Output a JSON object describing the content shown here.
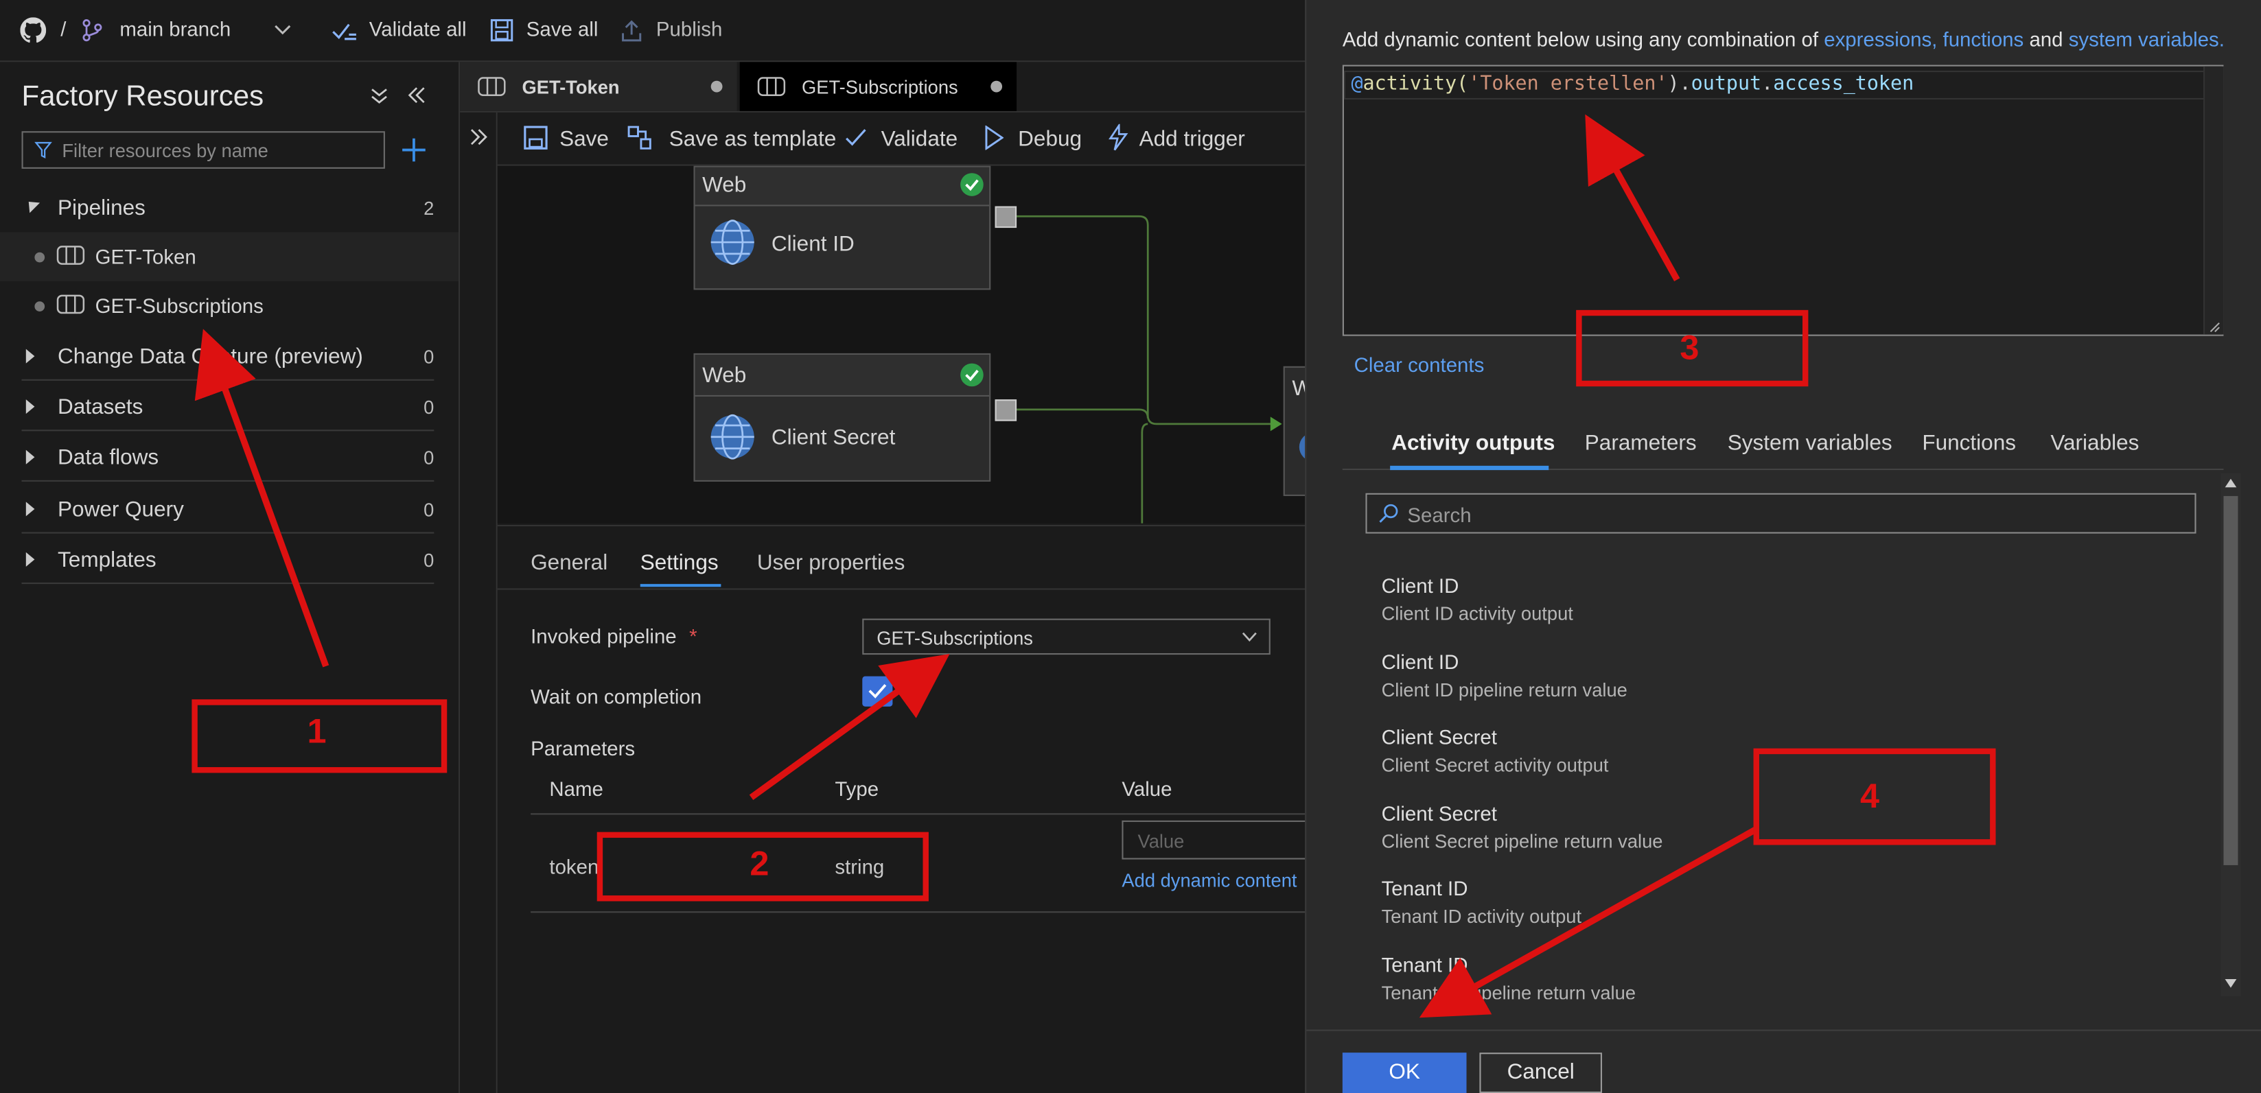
{
  "topbar": {
    "separator": "/",
    "branch": "main branch",
    "validate_all": "Validate all",
    "save_all": "Save all",
    "publish": "Publish"
  },
  "sidebar": {
    "title": "Factory Resources",
    "filter_placeholder": "Filter resources by name",
    "sections": [
      {
        "label": "Pipelines",
        "count": "2"
      },
      {
        "label": "Change Data Capture (preview)",
        "count": "0"
      },
      {
        "label": "Datasets",
        "count": "0"
      },
      {
        "label": "Data flows",
        "count": "0"
      },
      {
        "label": "Power Query",
        "count": "0"
      },
      {
        "label": "Templates",
        "count": "0"
      }
    ],
    "pipelines": [
      "GET-Token",
      "GET-Subscriptions"
    ]
  },
  "tabs": [
    "GET-Token",
    "GET-Subscriptions"
  ],
  "toolbar": {
    "save": "Save",
    "save_as_template": "Save as template",
    "validate": "Validate",
    "debug": "Debug",
    "add_trigger": "Add trigger"
  },
  "canvas": {
    "node_type": "Web",
    "nodes": [
      "Client ID",
      "Client Secret"
    ],
    "partial_node": "W"
  },
  "properties": {
    "tabs": [
      "General",
      "Settings",
      "User properties"
    ],
    "invoked_pipeline_label": "Invoked pipeline",
    "required_mark": "*",
    "invoked_pipeline_value": "GET-Subscriptions",
    "wait_label": "Wait on completion",
    "parameters_label": "Parameters",
    "columns": [
      "Name",
      "Type",
      "Value"
    ],
    "param_name": "token",
    "param_type": "string",
    "value_placeholder": "Value",
    "add_dynamic": "Add dynamic content"
  },
  "panel": {
    "intro_prefix": "Add dynamic content below using any combination of ",
    "intro_link1": "expressions, functions",
    "intro_and": " and ",
    "intro_link2": "system variables.",
    "expression": {
      "at": "@",
      "fn": "activity(",
      "str": "'Token erstellen'",
      "close": ").",
      "prop1": "output",
      "dot": ".",
      "prop2": "access_token"
    },
    "clear": "Clear contents",
    "tabs": [
      "Activity outputs",
      "Parameters",
      "System variables",
      "Functions",
      "Variables"
    ],
    "search_placeholder": "Search",
    "items": [
      {
        "title": "Client ID",
        "subtitle": "Client ID activity output"
      },
      {
        "title": "Client ID",
        "subtitle": "Client ID pipeline return value"
      },
      {
        "title": "Client Secret",
        "subtitle": "Client Secret activity output"
      },
      {
        "title": "Client Secret",
        "subtitle": "Client Secret pipeline return value"
      },
      {
        "title": "Tenant ID",
        "subtitle": "Tenant ID activity output"
      },
      {
        "title": "Tenant ID",
        "subtitle": "Tenant ID pipeline return value"
      }
    ],
    "ok": "OK",
    "cancel": "Cancel"
  },
  "annotations": [
    "1",
    "2",
    "3",
    "4"
  ],
  "colors": {
    "accent": "#3a6fd8",
    "annotation_red": "#dd1111",
    "link": "#5d9ff0",
    "success": "#2e9e4a"
  }
}
